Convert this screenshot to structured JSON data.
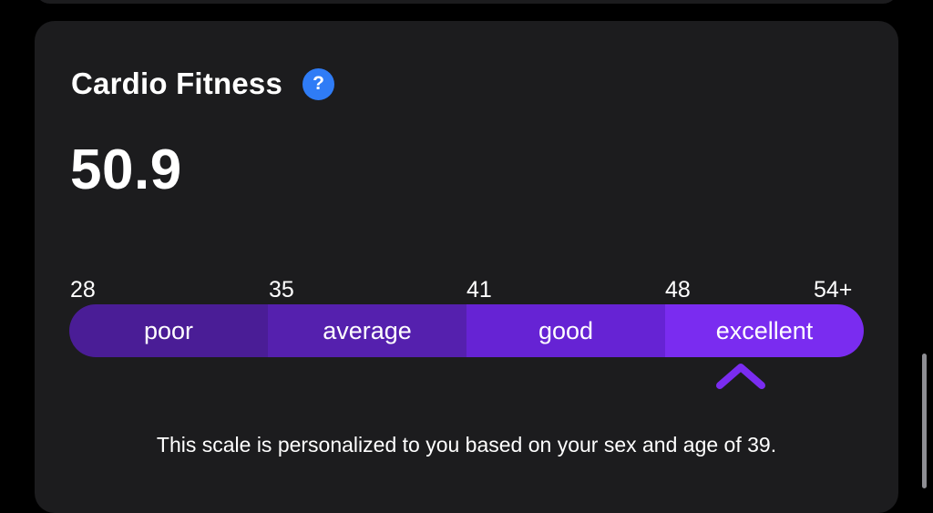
{
  "card": {
    "title": "Cardio Fitness",
    "help_icon": "question-mark-icon",
    "help_glyph": "?",
    "value": "50.9",
    "value_numeric": 50.9,
    "scale": {
      "ticks": [
        "28",
        "35",
        "41",
        "48",
        "54+"
      ],
      "segments": [
        {
          "label": "poor",
          "color": "#4a1d96"
        },
        {
          "label": "average",
          "color": "#5520ae"
        },
        {
          "label": "good",
          "color": "#6623d4"
        },
        {
          "label": "excellent",
          "color": "#7a2cf0"
        }
      ],
      "marker_color": "#7a2cf0",
      "marker_icon": "chevron-up-icon"
    },
    "footnote": "This scale is personalized to you based on your sex and age of 39."
  },
  "colors": {
    "background": "#000000",
    "card": "#1c1c1e",
    "accent_blue": "#2f7cf6"
  }
}
